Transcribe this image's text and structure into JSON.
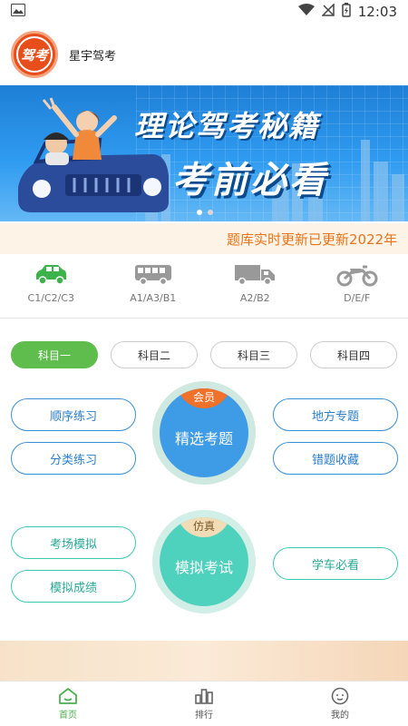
{
  "status_bar": {
    "time": "12:03"
  },
  "header": {
    "app_name": "星宇驾考",
    "logo_text": "驾考"
  },
  "banner": {
    "line1": "理论驾考秘籍",
    "line2": "考前必看"
  },
  "marquee": {
    "text": "题库实时更新已更新2022年"
  },
  "vehicles": [
    {
      "label": "C1/C2/C3",
      "icon": "car-icon",
      "active": true
    },
    {
      "label": "A1/A3/B1",
      "icon": "bus-icon",
      "active": false
    },
    {
      "label": "A2/B2",
      "icon": "truck-icon",
      "active": false
    },
    {
      "label": "D/E/F",
      "icon": "motorcycle-icon",
      "active": false
    }
  ],
  "subjects": [
    "科目一",
    "科目二",
    "科目三",
    "科目四"
  ],
  "practice": {
    "left_top": "顺序练习",
    "left_bottom": "分类练习",
    "center_badge": "会员",
    "center_label": "精选考题",
    "right_top": "地方专题",
    "right_bottom": "错题收藏"
  },
  "exam": {
    "left_top": "考场模拟",
    "left_bottom": "模拟成绩",
    "center_badge": "仿真",
    "center_label": "模拟考试",
    "right": "学车必看"
  },
  "bottom_nav": [
    {
      "label": "首页",
      "icon": "home-icon"
    },
    {
      "label": "排行",
      "icon": "ranking-icon"
    },
    {
      "label": "我的",
      "icon": "profile-icon"
    }
  ],
  "colors": {
    "accent_green": "#5fbd4e",
    "blue": "#3e9be6",
    "teal": "#4fd2bd",
    "orange": "#f0712a",
    "marquee_text": "#e8741a"
  }
}
